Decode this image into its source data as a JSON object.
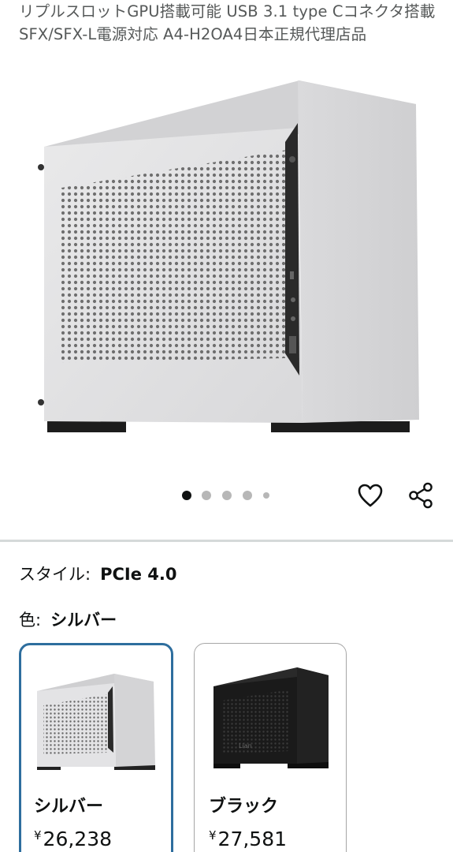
{
  "product": {
    "title": "リプルスロットGPU搭載可能 USB 3.1 type Cコネクタ搭載 SFX/SFX-L電源対応 A4-H2OA4日本正規代理店品"
  },
  "gallery": {
    "image_count": 5,
    "active_index": 0
  },
  "actions": {
    "favorite_icon": "heart-icon",
    "share_icon": "share-icon"
  },
  "variations": {
    "style_label": "スタイル:",
    "style_value": "PCIe 4.0",
    "color_label": "色:",
    "color_value": "シルバー",
    "options": [
      {
        "name": "シルバー",
        "currency": "¥",
        "price": "26,238",
        "selected": true
      },
      {
        "name": "ブラック",
        "currency": "¥",
        "price": "27,581",
        "selected": false
      }
    ]
  },
  "colors": {
    "selected_border": "#2e6e9e",
    "divider": "#d5d9d9",
    "text_secondary": "#565959"
  }
}
